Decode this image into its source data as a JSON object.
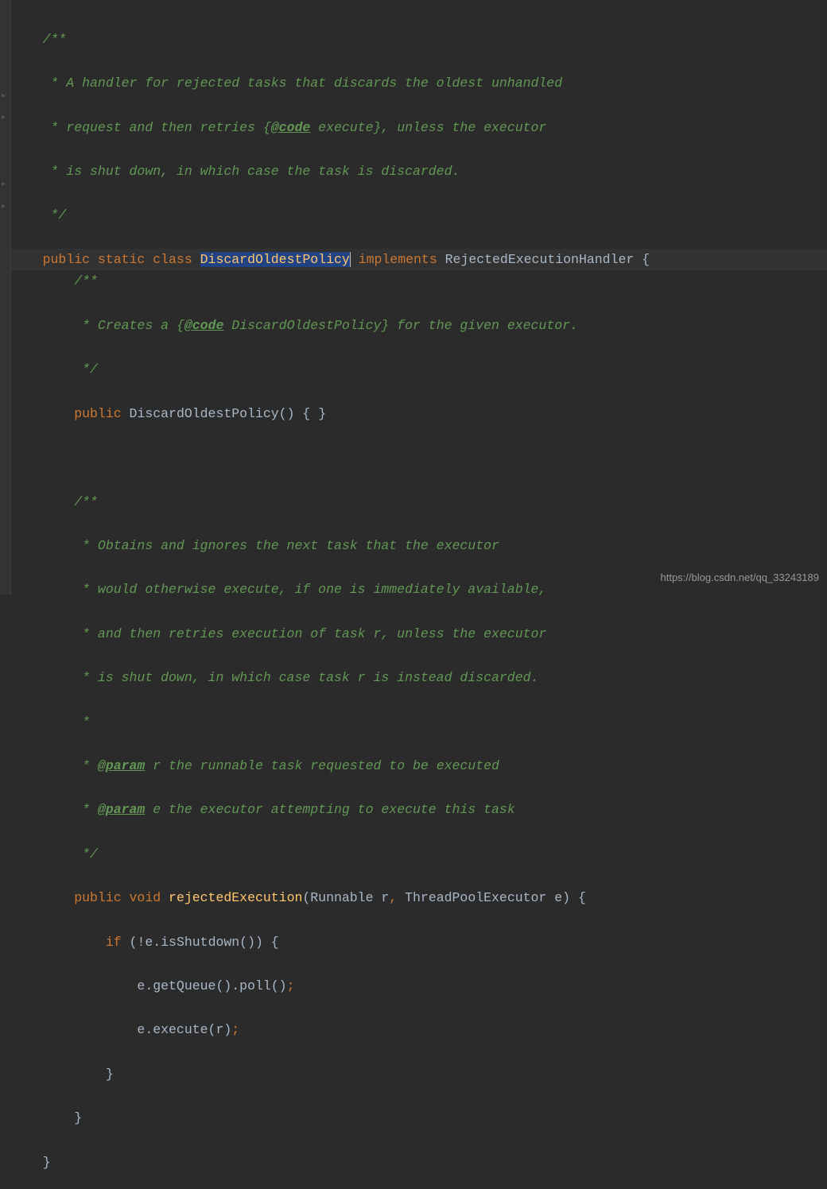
{
  "code": {
    "l1_a": "    /**",
    "l2_a": "     * A handler for rejected tasks that discards the oldest unhandled",
    "l3_a": "     * request and then retries {",
    "l3_tag": "@code",
    "l3_b": " execute}, unless the executor",
    "l4_a": "     * is shut down, in which case the task is discarded.",
    "l5_a": "     */",
    "l6_kw1": "public static class ",
    "l6_cls": "DiscardOldestPolicy",
    "l6_kw2": " implements ",
    "l6_type": "RejectedExecutionHandler ",
    "l6_brace": "{",
    "l7_a": "        /**",
    "l8_a": "         * Creates a {",
    "l8_tag": "@code",
    "l8_b": " DiscardOldestPolicy} for the given executor.",
    "l9_a": "         */",
    "l10_kw": "        public ",
    "l10_ctor": "DiscardOldestPolicy",
    "l10_paren": "() ",
    "l10_br": "{ }",
    "l12_a": "        /**",
    "l13_a": "         * Obtains and ignores the next task that the executor",
    "l14_a": "         * would otherwise execute, if one is immediately available,",
    "l15_a": "         * and then retries execution of task r, unless the executor",
    "l16_a": "         * is shut down, in which case task r is instead discarded.",
    "l17_a": "         *",
    "l18_a": "         * ",
    "l18_tag": "@param",
    "l18_b": " r the runnable task requested to be executed",
    "l19_a": "         * ",
    "l19_tag": "@param",
    "l19_b": " e the executor attempting to execute this task",
    "l20_a": "         */",
    "l21_kw": "        public void ",
    "l21_m": "rejectedExecution",
    "l21_p": "(Runnable r",
    "l21_c": ", ",
    "l21_p2": "ThreadPoolExecutor e) ",
    "l21_br": "{",
    "l22_pad": "            ",
    "l22_if": "if ",
    "l22_cond": "(!e.isShutdown()) {",
    "l23_a": "                e.getQueue().poll()",
    "l23_semi": ";",
    "l24_a": "                e.execute(r)",
    "l24_semi": ";",
    "l25_a": "            }",
    "l26_a": "        }",
    "l27_a": "    }"
  },
  "indent": "    ",
  "watermark": "https://blog.csdn.net/qq_33243189"
}
